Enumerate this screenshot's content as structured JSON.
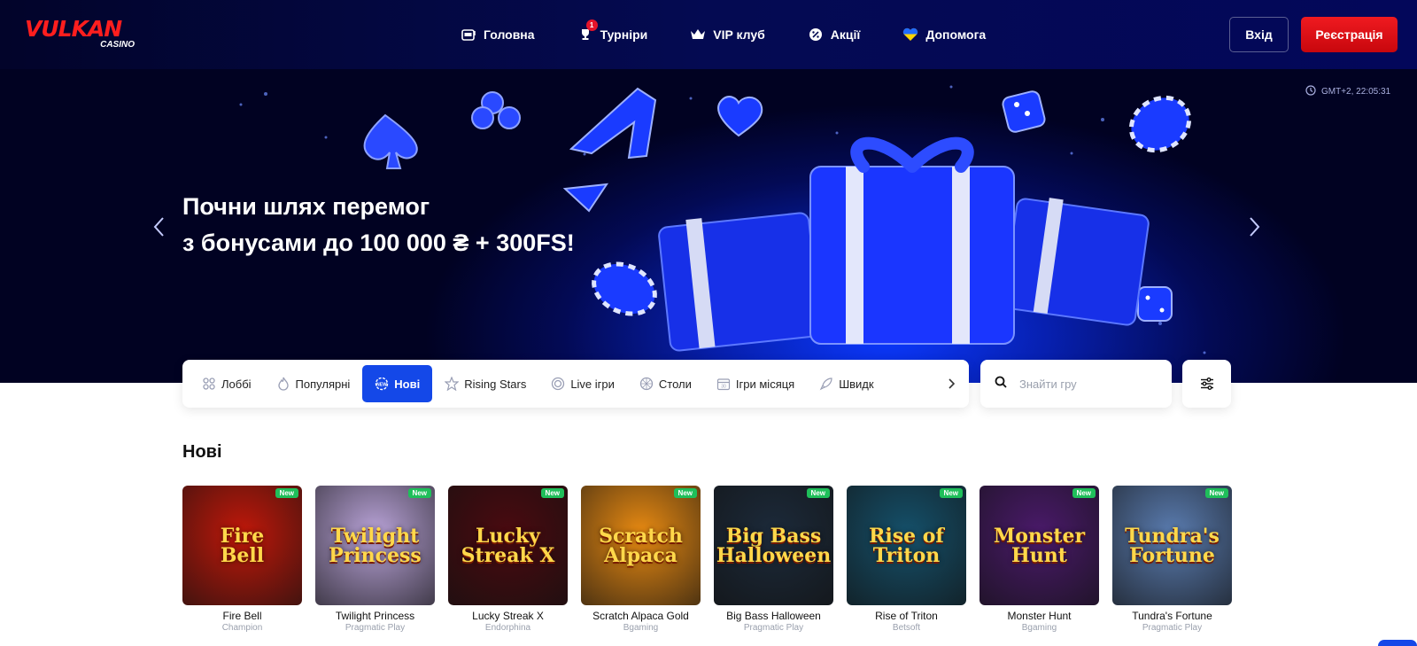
{
  "header": {
    "logo_main": "VULKAN",
    "logo_sub": "CASINO",
    "nav": [
      {
        "label": "Головна",
        "icon": "slot-machine-icon"
      },
      {
        "label": "Турніри",
        "icon": "trophy-icon",
        "badge": "1"
      },
      {
        "label": "VIP клуб",
        "icon": "crown-icon"
      },
      {
        "label": "Акції",
        "icon": "percent-icon"
      },
      {
        "label": "Допомога",
        "icon": "heart-flag-icon"
      }
    ],
    "login_label": "Вхід",
    "register_label": "Реєстрація",
    "colors": {
      "brand": "#ff1e1e",
      "register": "#e0121a",
      "bg": "#040a52"
    }
  },
  "hero": {
    "title_line1": "Почни шлях перемог",
    "title_line2": "з бонусами до 100 000 ₴ + 300FS!",
    "time": "GMT+2, 22:05:31",
    "slides": 5,
    "active_slide": 1
  },
  "categories": {
    "items": [
      {
        "label": "Лоббі",
        "icon": "grid-icon",
        "active": false
      },
      {
        "label": "Популярні",
        "icon": "flame-icon",
        "active": false
      },
      {
        "label": "Нові",
        "icon": "new-icon",
        "active": true
      },
      {
        "label": "Rising Stars",
        "icon": "star-icon",
        "active": false
      },
      {
        "label": "Live ігри",
        "icon": "live-icon",
        "active": false
      },
      {
        "label": "Столи",
        "icon": "roulette-icon",
        "active": false
      },
      {
        "label": "Ігри місяця",
        "icon": "calendar-icon",
        "active": false
      },
      {
        "label": "Швидк",
        "icon": "rocket-icon",
        "active": false
      }
    ],
    "accent": "#1448e8"
  },
  "search": {
    "placeholder": "Знайти гру"
  },
  "section": {
    "title": "Нові"
  },
  "games": [
    {
      "name": "Fire Bell",
      "provider": "Champion",
      "badge": "New",
      "art": "Fire\nBell",
      "bg": "#c0180a"
    },
    {
      "name": "Twilight Princess",
      "provider": "Pragmatic Play",
      "badge": "New",
      "art": "Twilight\nPrincess",
      "bg": "#b9a3d8"
    },
    {
      "name": "Lucky Streak X",
      "provider": "Endorphina",
      "badge": "New",
      "art": "Lucky\nStreak X",
      "bg": "#4a0a10"
    },
    {
      "name": "Scratch Alpaca Gold",
      "provider": "Bgaming",
      "badge": "New",
      "art": "Scratch\nAlpaca",
      "bg": "#e88a12"
    },
    {
      "name": "Big Bass Halloween",
      "provider": "Pragmatic Play",
      "badge": "New",
      "art": "Big Bass\nHalloween",
      "bg": "#1c2a3a"
    },
    {
      "name": "Rise of Triton",
      "provider": "Betsoft",
      "badge": "New",
      "art": "Rise of\nTriton",
      "bg": "#15506a"
    },
    {
      "name": "Monster Hunt",
      "provider": "Bgaming",
      "badge": "New",
      "art": "Monster\nHunt",
      "bg": "#4a1a6a"
    },
    {
      "name": "Tundra's Fortune",
      "provider": "Pragmatic Play",
      "badge": "New",
      "art": "Tundra's\nFortune",
      "bg": "#5a7cb0"
    }
  ]
}
